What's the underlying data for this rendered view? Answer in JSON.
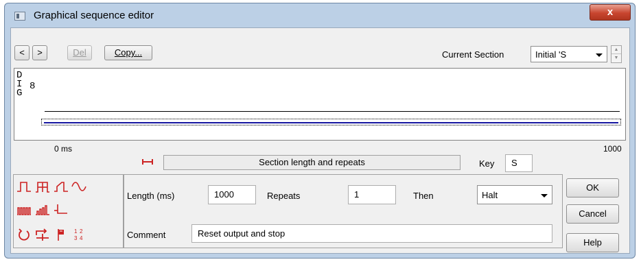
{
  "window": {
    "title": "Graphical sequence editor",
    "close_label": "x"
  },
  "toolbar": {
    "prev_label": "<",
    "next_label": ">",
    "del_label": "Del",
    "copy_label": "Copy..."
  },
  "section": {
    "label": "Current Section",
    "selected": "Initial 'S"
  },
  "canvas": {
    "channel_label": [
      "D",
      "I",
      "G"
    ],
    "channel_number": "8",
    "start_label": "0 ms",
    "end_label": "1000",
    "trace_color": "#1616a0"
  },
  "section_bar": {
    "label": "Section length and repeats",
    "accent_color": "#cc2222"
  },
  "key": {
    "label": "Key",
    "value": "S"
  },
  "params": {
    "length_label": "Length (ms)",
    "length_value": "1000",
    "repeats_label": "Repeats",
    "repeats_value": "1",
    "then_label": "Then",
    "then_selected": "Halt",
    "comment_label": "Comment",
    "comment_value": "Reset output and stop"
  },
  "actions": {
    "ok_label": "OK",
    "cancel_label": "Cancel",
    "help_label": "Help"
  },
  "palette": {
    "icon_color": "#cc2222",
    "icons": [
      "pulse-icon",
      "pulse-train-icon",
      "ramp-icon",
      "sine-icon",
      "burst-icon",
      "variable-burst-icon",
      "step-down-icon",
      "loop-back-icon",
      "jump-icon",
      "flag-icon",
      "number-table-icon"
    ],
    "table_glyph": "1 2\n3 4"
  }
}
